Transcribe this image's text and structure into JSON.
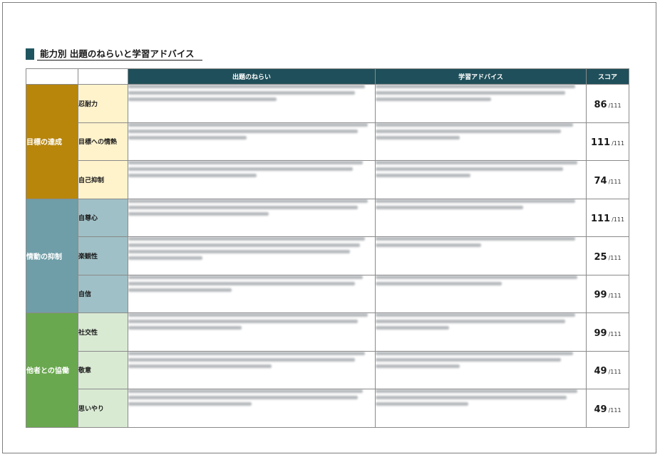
{
  "document": {
    "title": "能力別 出題のねらいと学習アドバイス"
  },
  "table": {
    "headers": {
      "aim": "出題のねらい",
      "advice": "学習アドバイス",
      "score": "スコア"
    },
    "groups": [
      {
        "label": "目標の達成",
        "items": [
          {
            "label": "忍耐力",
            "score": "86",
            "max": "/111"
          },
          {
            "label": "目標への情熱",
            "score": "111",
            "max": "/111"
          },
          {
            "label": "自己抑制",
            "score": "74",
            "max": "/111"
          }
        ]
      },
      {
        "label": "情動の抑制",
        "items": [
          {
            "label": "自尊心",
            "score": "111",
            "max": "/111"
          },
          {
            "label": "楽観性",
            "score": "25",
            "max": "/111"
          },
          {
            "label": "自信",
            "score": "99",
            "max": "/111"
          }
        ]
      },
      {
        "label": "他者との協働",
        "items": [
          {
            "label": "社交性",
            "score": "99",
            "max": "/111"
          },
          {
            "label": "敬意",
            "score": "49",
            "max": "/111"
          },
          {
            "label": "思いやり",
            "score": "49",
            "max": "/111"
          }
        ]
      }
    ]
  },
  "colors": {
    "header_bg": "#1f4f5a",
    "group_1": "#b8860b",
    "group_2": "#6f9ea8",
    "group_3": "#6aa84f"
  }
}
